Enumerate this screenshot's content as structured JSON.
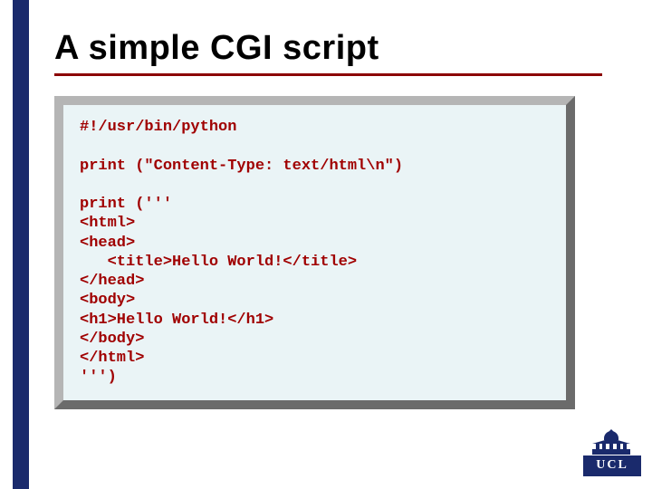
{
  "title": "A simple CGI script",
  "code": "#!/usr/bin/python\n\nprint (\"Content-Type: text/html\\n\")\n\nprint ('''\n<html>\n<head>\n   <title>Hello World!</title>\n</head>\n<body>\n<h1>Hello World!</h1>\n</body>\n</html>\n''')",
  "logo_text": "UCL",
  "colors": {
    "sidebar": "#1a2a6c",
    "underline": "#8b0000",
    "code_text": "#a00000",
    "code_bg": "#eaf4f6"
  }
}
